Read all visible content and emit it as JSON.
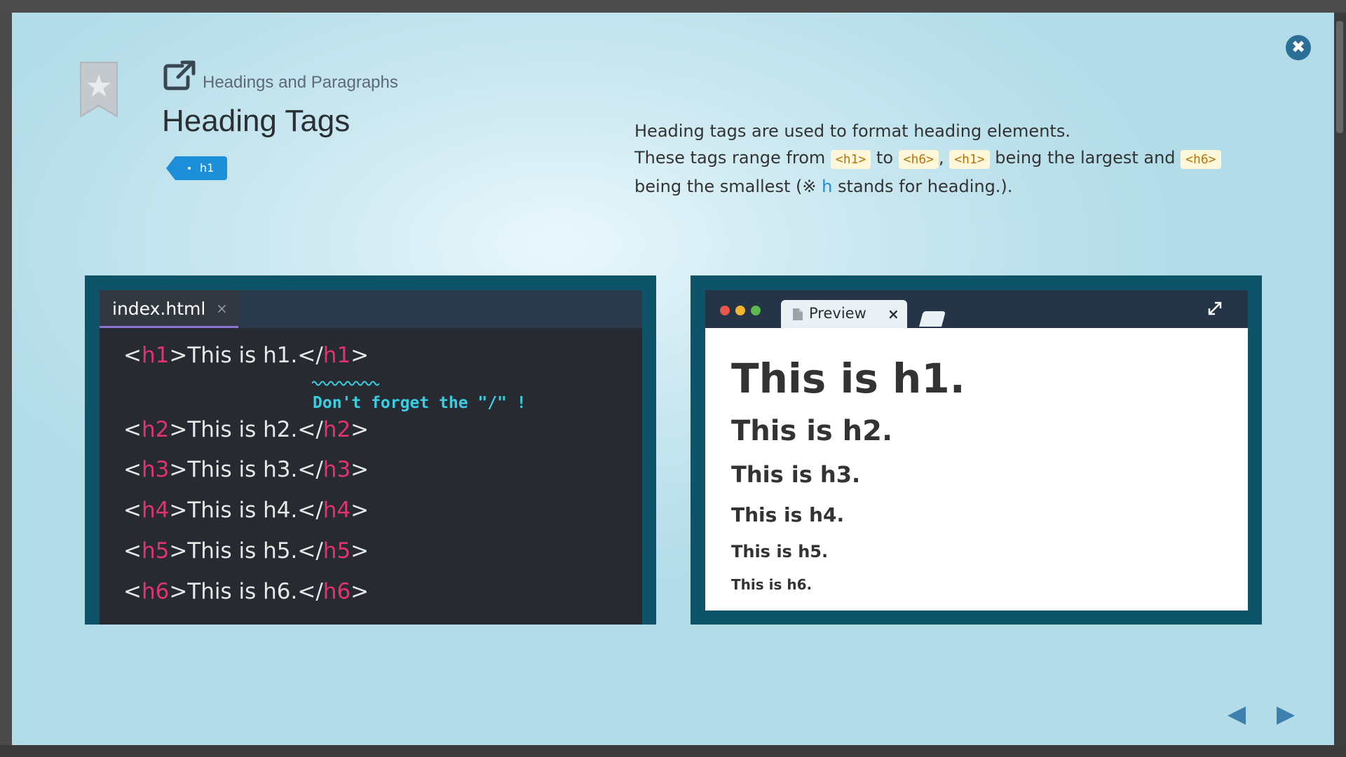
{
  "lesson": {
    "breadcrumb": "Headings and Paragraphs",
    "title": "Heading Tags",
    "tag": "h1"
  },
  "description": {
    "line1": "Heading tags are used to format heading elements.",
    "line2_a": "These tags range from ",
    "code_h1": "<h1>",
    "line2_to": " to ",
    "code_h6": "<h6>",
    "line2_comma": ", ",
    "line2_b": " being the largest and ",
    "line3_a": "being the smallest (※ ",
    "line3_h": "h",
    "line3_b": " stands for heading.)."
  },
  "editor": {
    "filename": "index.html",
    "close": "×",
    "tip": "Don't forget the \"/\" !",
    "lines": [
      {
        "open": "<",
        "tag": "h1",
        "mid": ">This is h1.</",
        "tag2": "h1",
        "close": ">"
      },
      {
        "open": "<",
        "tag": "h2",
        "mid": ">This is h2.</",
        "tag2": "h2",
        "close": ">"
      },
      {
        "open": "<",
        "tag": "h3",
        "mid": ">This is h3.</",
        "tag2": "h3",
        "close": ">"
      },
      {
        "open": "<",
        "tag": "h4",
        "mid": ">This is h4.</",
        "tag2": "h4",
        "close": ">"
      },
      {
        "open": "<",
        "tag": "h5",
        "mid": ">This is h5.</",
        "tag2": "h5",
        "close": ">"
      },
      {
        "open": "<",
        "tag": "h6",
        "mid": ">This is h6.</",
        "tag2": "h6",
        "close": ">"
      }
    ]
  },
  "preview": {
    "tab_label": "Preview",
    "close": "×",
    "headings": [
      "This is h1.",
      "This is h2.",
      "This is h3.",
      "This is h4.",
      "This is h5.",
      "This is h6."
    ]
  },
  "icons": {
    "close": "✖",
    "bookmark": "star-bookmark-icon",
    "external": "external-link-icon",
    "expand": "expand-icon",
    "prev": "arrow-left-icon",
    "next": "arrow-right-icon"
  },
  "colors": {
    "accent": "#1b8fd8",
    "code_tag": "#e0336f",
    "tip": "#39cfe3",
    "frame": "#0e5468",
    "editor_bg": "#272a30"
  }
}
